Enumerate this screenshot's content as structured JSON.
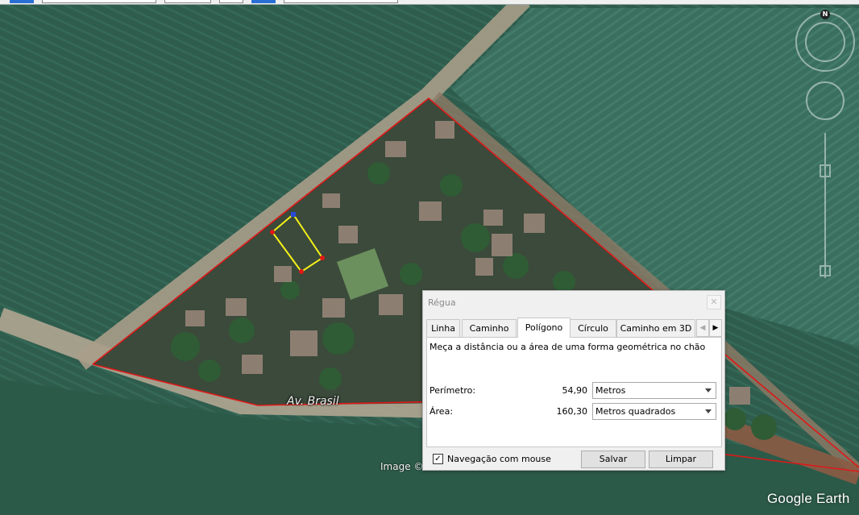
{
  "map": {
    "street_label": "Av. Brasil",
    "image_credit": "Image © ",
    "logo": "Google Earth",
    "north_label": "N"
  },
  "ruler": {
    "title": "Régua",
    "close_label": "✕",
    "tabs": [
      "Linha",
      "Caminho",
      "Polígono",
      "Círculo",
      "Caminho em 3D"
    ],
    "active_tab": "Polígono",
    "description": "Meça a distância ou a área de uma forma geométrica no chão",
    "perimeter": {
      "label": "Perímetro:",
      "value": "54,90",
      "unit": "Metros"
    },
    "area": {
      "label": "Área:",
      "value": "160,30",
      "unit": "Metros quadrados"
    },
    "mouse_nav": {
      "label": "Navegação com mouse",
      "checked": true
    },
    "save_label": "Salvar",
    "clear_label": "Limpar"
  },
  "colors": {
    "boundary": "#e01818",
    "measure_polygon": "#f4f01a",
    "vertex": "#e01818"
  }
}
